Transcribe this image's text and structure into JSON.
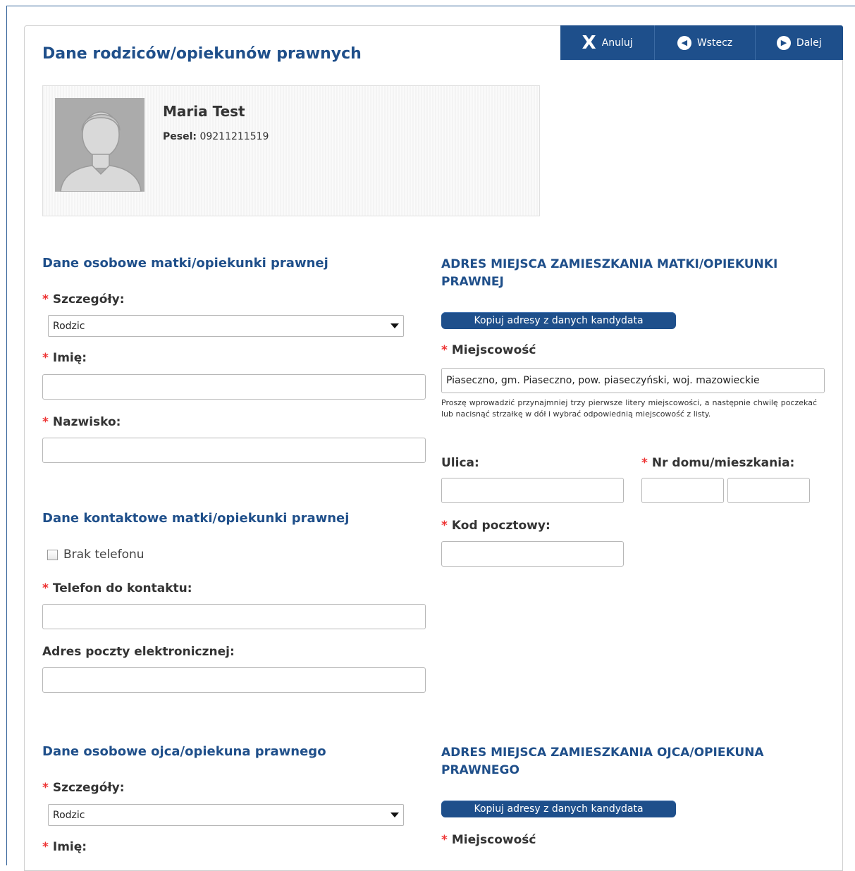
{
  "toolbar": {
    "cancel_label": "Anuluj",
    "back_label": "Wstecz",
    "next_label": "Dalej"
  },
  "page_title": "Dane rodziców/opiekunów prawnych",
  "candidate": {
    "name": "Maria Test",
    "pesel_label": "Pesel:",
    "pesel_value": "09211211519"
  },
  "mother": {
    "personal_title": "Dane osobowe matki/opiekunki prawnej",
    "details_label": "Szczegóły:",
    "details_value": "Rodzic",
    "first_name_label": "Imię:",
    "first_name_value": "",
    "last_name_label": "Nazwisko:",
    "last_name_value": "",
    "contact_title": "Dane kontaktowe matki/opiekunki prawnej",
    "no_phone_label": "Brak telefonu",
    "phone_label": "Telefon do kontaktu:",
    "phone_value": "",
    "email_label": "Adres poczty elektronicznej:",
    "email_value": "",
    "address_title": "ADRES MIEJSCA ZAMIESZKANIA MATKI/OPIEKUNKI PRAWNEJ",
    "copy_button": "Kopiuj adresy z danych kandydata",
    "city_label": "Miejscowość",
    "city_value": "Piaseczno, gm. Piaseczno, pow. piaseczyński, woj. mazowieckie",
    "city_hint": "Proszę wprowadzić przynajmniej trzy pierwsze litery miejscowości, a następnie chwilę poczekać lub nacisnąć strzałkę w dół i wybrać odpowiednią miejscowość z listy.",
    "street_label": "Ulica:",
    "street_value": "",
    "house_label": "Nr domu/mieszkania:",
    "house_value": "",
    "flat_value": "",
    "postal_label": "Kod pocztowy:",
    "postal_value": ""
  },
  "father": {
    "personal_title": "Dane osobowe ojca/opiekuna prawnego",
    "details_label": "Szczegóły:",
    "details_value": "Rodzic",
    "first_name_label": "Imię:",
    "address_title": "ADRES MIEJSCA ZAMIESZKANIA OJCA/OPIEKUNA PRAWNEGO",
    "copy_button": "Kopiuj adresy z danych kandydata",
    "city_label": "Miejscowość"
  },
  "colors": {
    "brand": "#1e4f8b",
    "heading": "#1f4f8a",
    "required": "#ee3333"
  }
}
